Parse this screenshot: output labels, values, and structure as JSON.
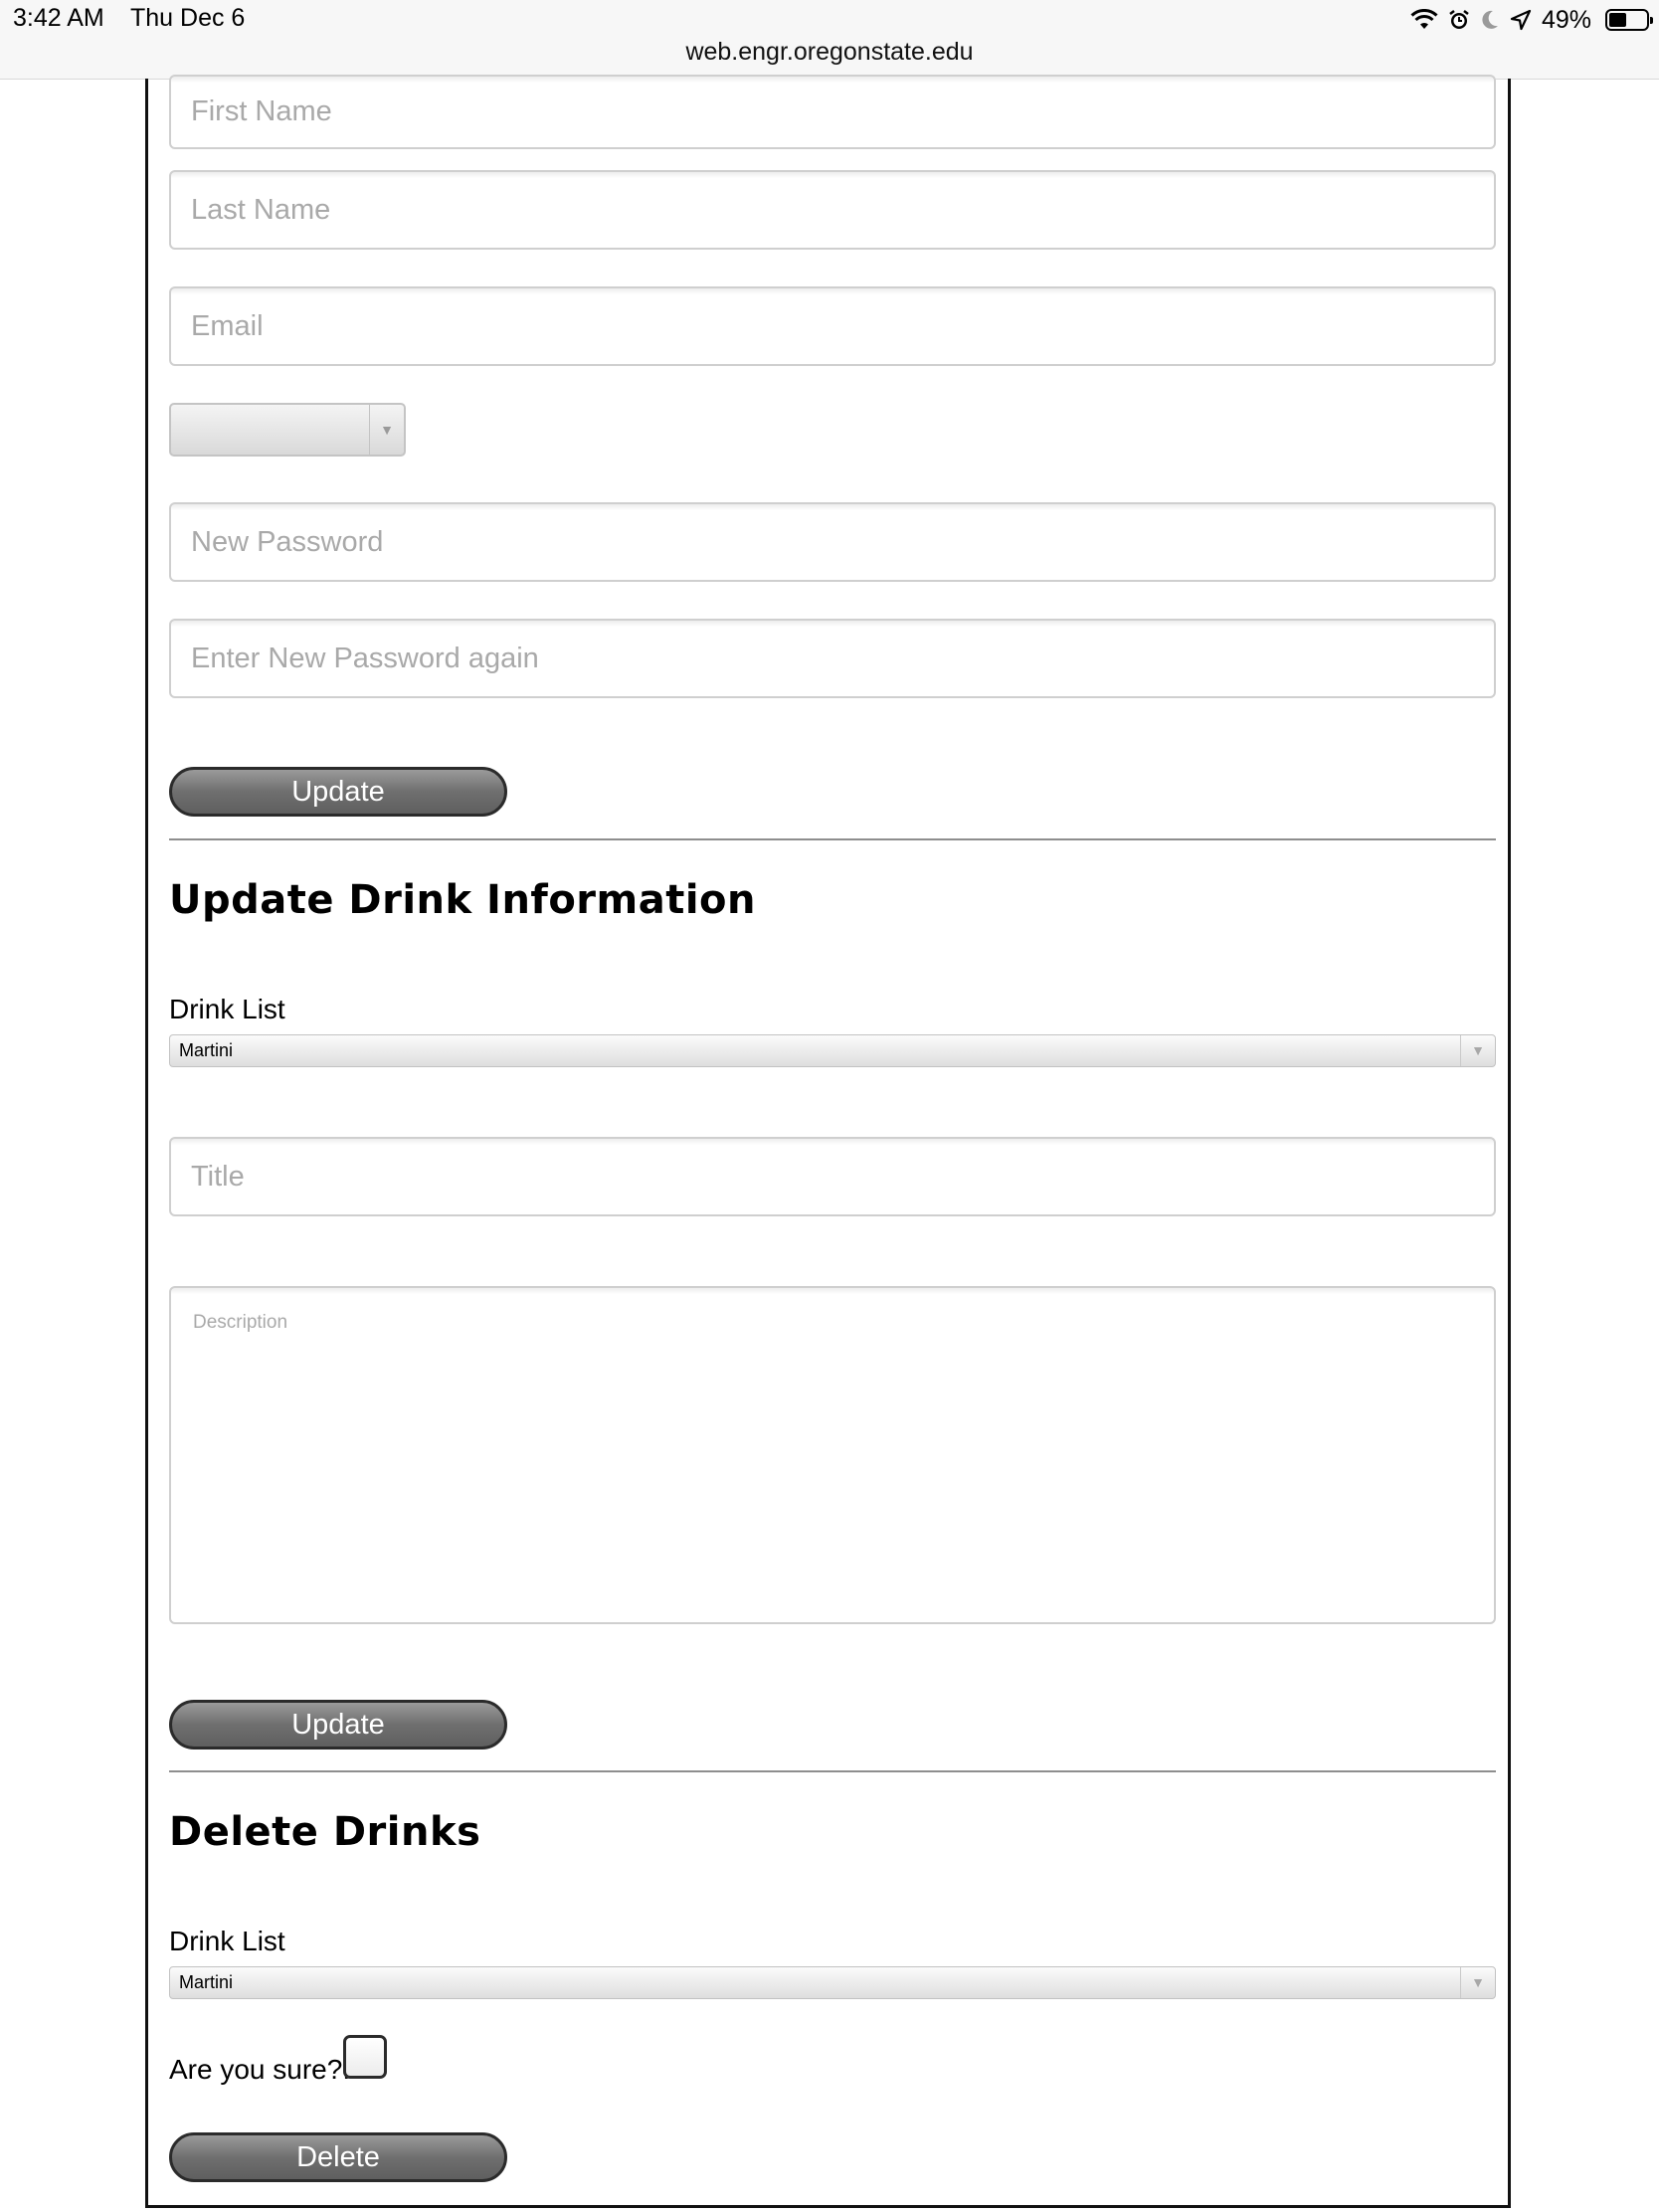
{
  "status_bar": {
    "time": "3:42 AM",
    "date": "Thu Dec 6",
    "url": "web.engr.oregonstate.edu",
    "battery": "49%",
    "icons": [
      "wifi-icon",
      "alarm-icon",
      "moon-icon",
      "location-arrow-icon",
      "battery-icon"
    ]
  },
  "account_form": {
    "first_name_placeholder": "First Name",
    "last_name_placeholder": "Last Name",
    "email_placeholder": "Email",
    "new_password_placeholder": "New Password",
    "confirm_password_placeholder": "Enter New Password again",
    "update_label": "Update"
  },
  "drink_update": {
    "heading": "Update Drink Information",
    "drink_list_label": "Drink List",
    "drink_selected": "Martini",
    "title_placeholder": "Title",
    "description_placeholder": "Description",
    "update_label": "Update"
  },
  "drink_delete": {
    "heading": "Delete Drinks",
    "drink_list_label": "Drink List",
    "drink_selected": "Martini",
    "confirm_label": "Are you sure?:",
    "confirm_checked": false,
    "delete_label": "Delete"
  }
}
